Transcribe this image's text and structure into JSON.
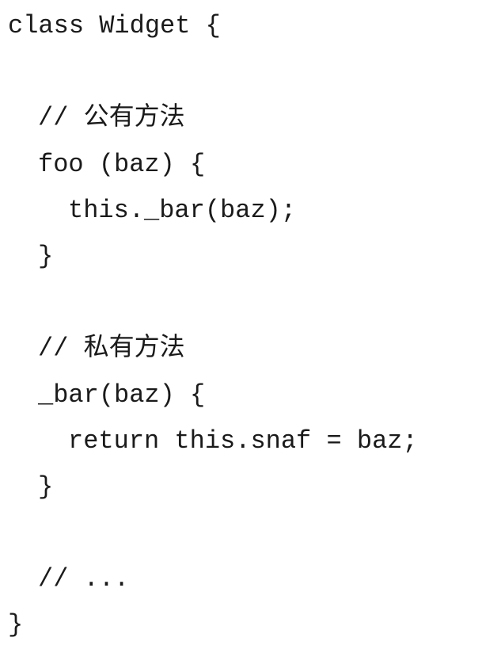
{
  "code": {
    "lines": [
      {
        "text": "class Widget {"
      },
      {
        "text": ""
      },
      {
        "text": "// 公有方法"
      },
      {
        "text": "foo (baz) {"
      },
      {
        "text": "this._bar(baz);"
      },
      {
        "text": "}"
      },
      {
        "text": ""
      },
      {
        "text": "// 私有方法"
      },
      {
        "text": "_bar(baz) {"
      },
      {
        "text": "return this.snaf = baz;"
      },
      {
        "text": "}"
      },
      {
        "text": ""
      },
      {
        "text": "// ..."
      },
      {
        "text": "}"
      }
    ]
  }
}
